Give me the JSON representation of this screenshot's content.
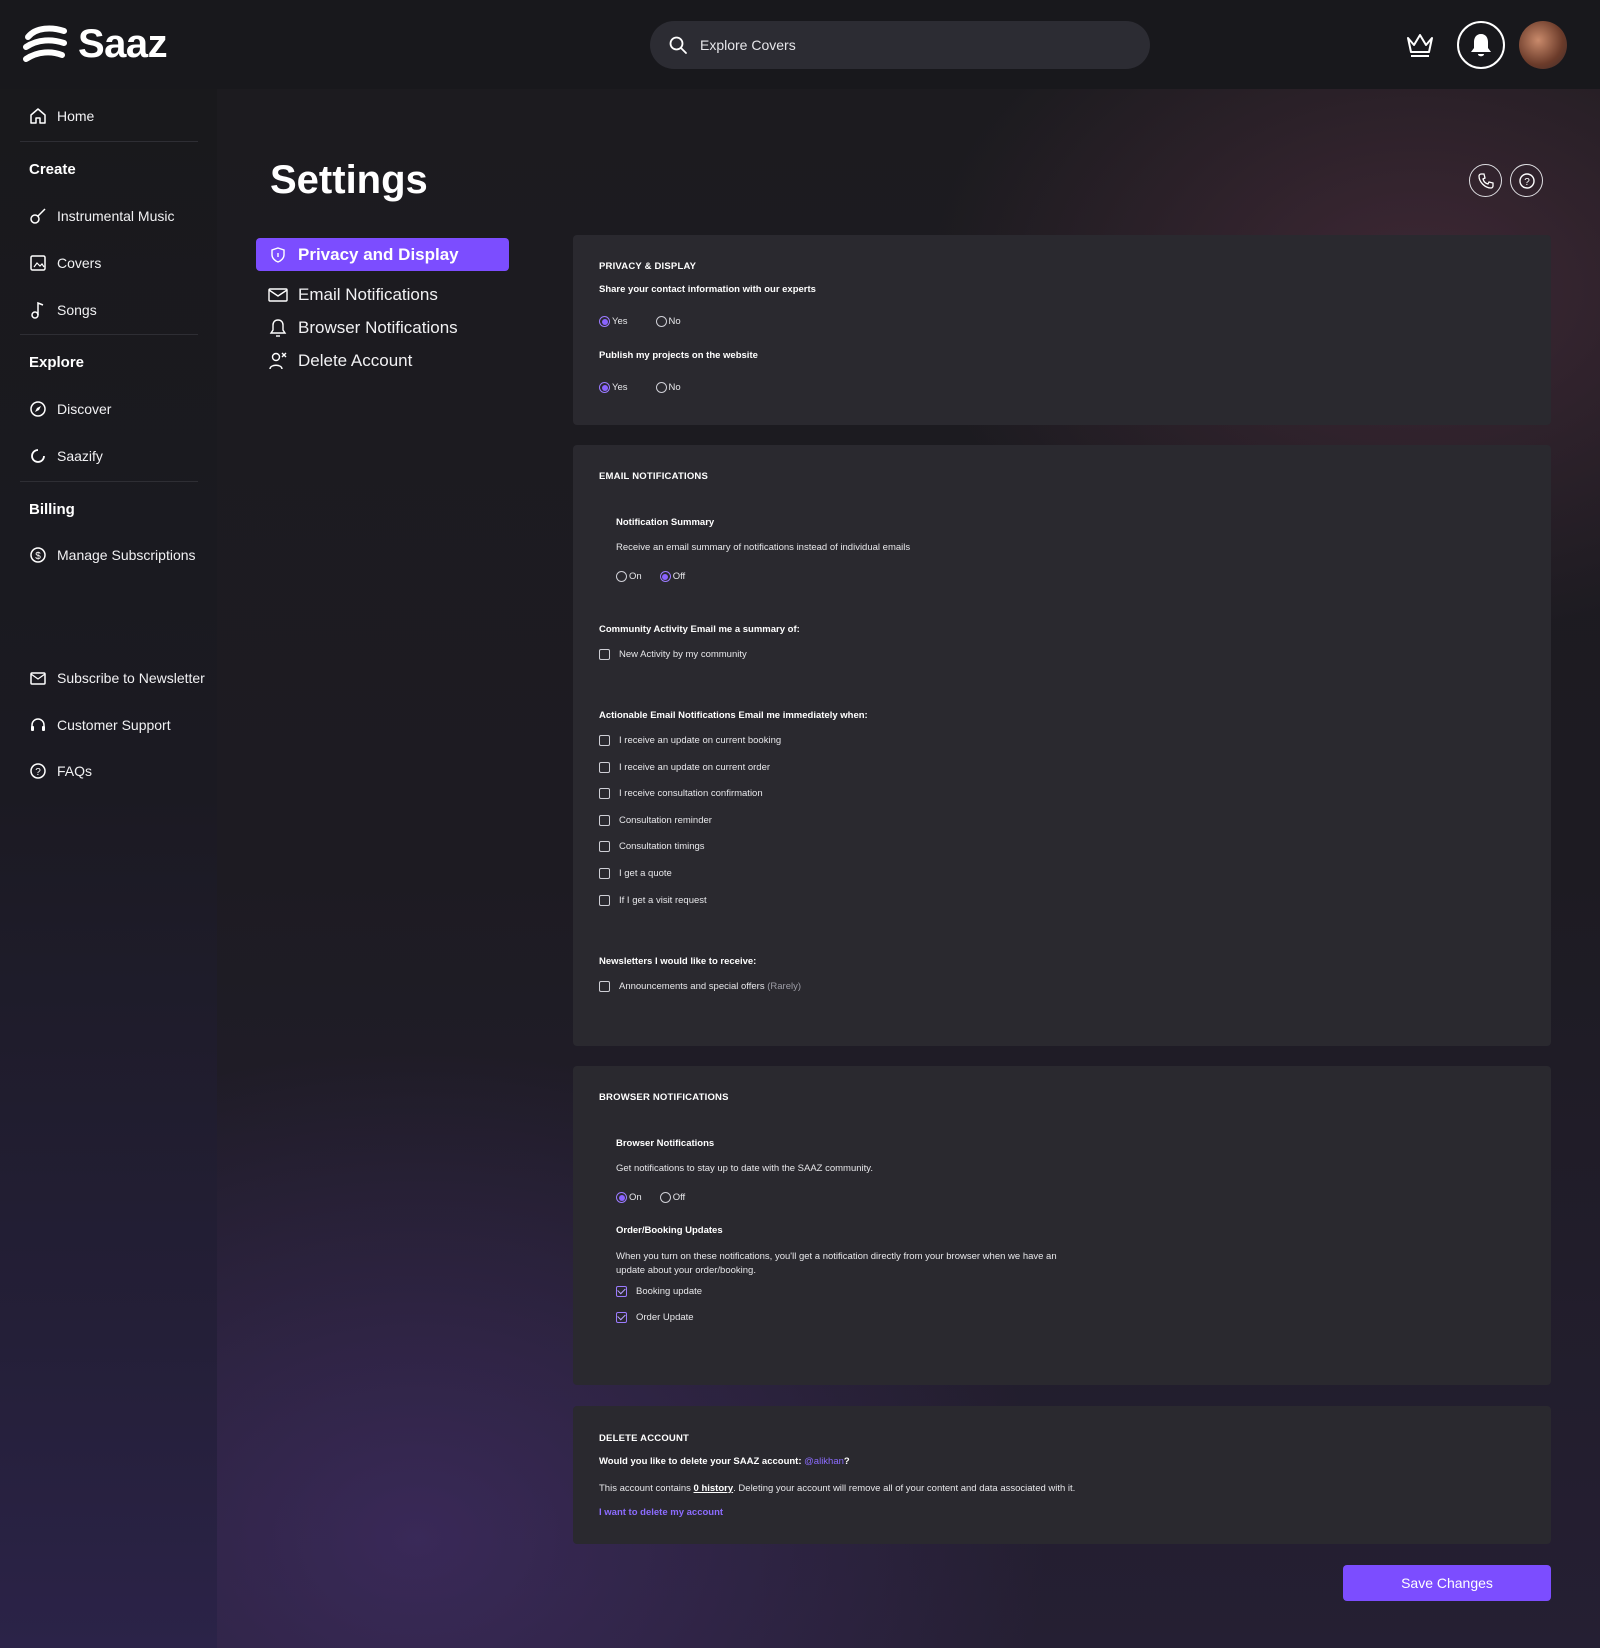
{
  "app": {
    "name": "Saaz"
  },
  "header": {
    "search_placeholder": "Explore Covers"
  },
  "sidebar": {
    "home": "Home",
    "create_heading": "Create",
    "instrumental": "Instrumental Music",
    "covers": "Covers",
    "songs": "Songs",
    "explore_heading": "Explore",
    "discover": "Discover",
    "saazify": "Saazify",
    "billing_heading": "Billing",
    "manage_subs": "Manage Subscriptions",
    "newsletter": "Subscribe to Newsletter",
    "support": "Customer Support",
    "faqs": "FAQs"
  },
  "page": {
    "title": "Settings"
  },
  "settings_nav": {
    "privacy": "Privacy and Display",
    "email": "Email Notifications",
    "browser": "Browser Notifications",
    "delete": "Delete Account"
  },
  "privacy": {
    "title": "PRIVACY & DISPLAY",
    "q1": "Share your contact information with our experts",
    "q1_yes": "Yes",
    "q1_no": "No",
    "q1_selected": "Yes",
    "q2": "Publish my projects on the website",
    "q2_yes": "Yes",
    "q2_no": "No",
    "q2_selected": "Yes"
  },
  "email": {
    "title": "EMAIL NOTIFICATIONS",
    "summary_title": "Notification Summary",
    "summary_desc": "Receive an email summary of notifications instead of individual emails",
    "summary_on": "On",
    "summary_off": "Off",
    "summary_selected": "Off",
    "community_label": "Community Activity Email me a summary of:",
    "community_item": "New Activity by my community",
    "actionable_label": "Actionable Email Notifications Email me immediately when:",
    "actionable_items": [
      "I receive an update on current booking",
      "I receive an update on current order",
      "I receive consultation confirmation",
      "Consultation reminder",
      "Consultation timings",
      "I get a quote",
      "If I get a visit request"
    ],
    "newsletter_label": "Newsletters I would like to receive:",
    "newsletter_item": "Announcements and special offers",
    "newsletter_freq": "(Rarely)"
  },
  "browser": {
    "title": "BROWSER NOTIFICATIONS",
    "sub_title": "Browser Notifications",
    "desc": "Get notifications to stay up to date with the SAAZ community.",
    "on": "On",
    "off": "Off",
    "selected": "On",
    "order_title": "Order/Booking Updates",
    "order_desc_1": "When you turn on these notifications, you'll get a notification directly from your browser when we have an",
    "order_desc_2": "update about your order/booking.",
    "booking_update": "Booking update",
    "order_update": "Order Update"
  },
  "delete": {
    "title": "DELETE ACCOUNT",
    "question_pre": "Would you like to delete your SAAZ account: ",
    "handle": "@alikhan",
    "question_post": "?",
    "info_pre": "This account contains ",
    "info_history": "0 history",
    "info_post": ". Deleting your account will remove all of your content and data associated with it.",
    "link": "I want to delete my account"
  },
  "actions": {
    "save": "Save Changes"
  },
  "colors": {
    "accent": "#7c4dff",
    "panel": "#2a292f",
    "background": "#17171b"
  }
}
